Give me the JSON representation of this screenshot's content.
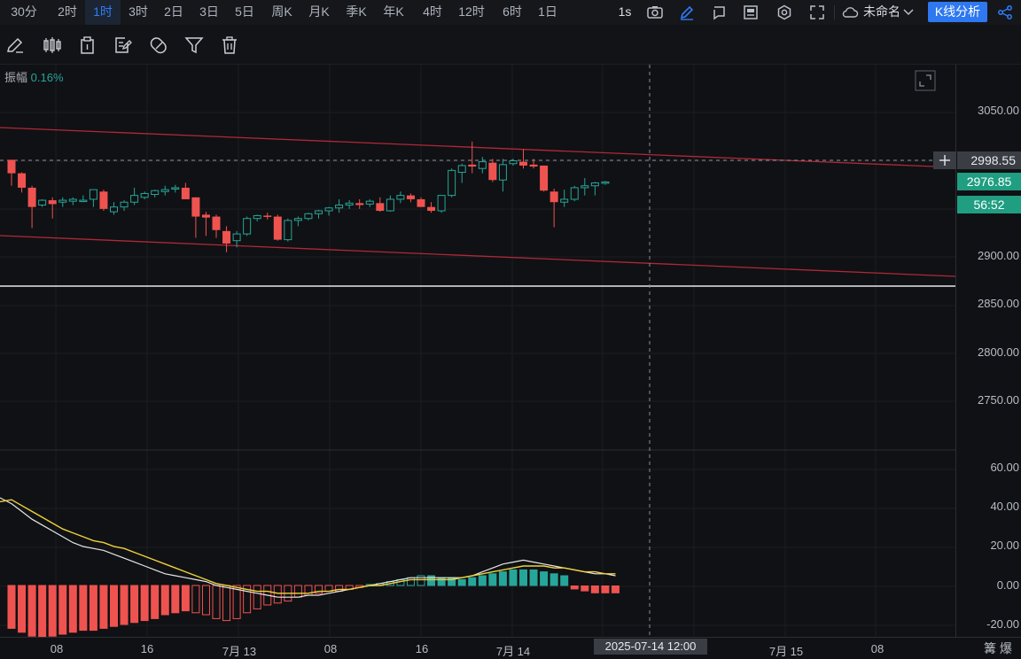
{
  "timeframes": [
    {
      "label": "30分",
      "active": false
    },
    {
      "label": "2时",
      "active": false
    },
    {
      "label": "1时",
      "active": true
    },
    {
      "label": "3时",
      "active": false
    },
    {
      "label": "2日",
      "active": false
    },
    {
      "label": "3日",
      "active": false
    },
    {
      "label": "5日",
      "active": false
    },
    {
      "label": "周K",
      "active": false
    },
    {
      "label": "月K",
      "active": false
    },
    {
      "label": "季K",
      "active": false
    },
    {
      "label": "年K",
      "active": false
    },
    {
      "label": "4时",
      "active": false
    },
    {
      "label": "12时",
      "active": false
    },
    {
      "label": "6时",
      "active": false
    },
    {
      "label": "1日",
      "active": false
    }
  ],
  "topbar": {
    "interval_badge": "1s",
    "layout_name": "未命名",
    "analysis_button": "K线分析"
  },
  "amplitude": {
    "label": "振幅",
    "value": "0.16%"
  },
  "price_axis": [
    "3050.00",
    "2900.00",
    "2850.00",
    "2800.00",
    "2750.00"
  ],
  "price_tags": {
    "crosshair": "2998.55",
    "last": "2976.85",
    "countdown": "56:52"
  },
  "macd_axis": [
    "60.00",
    "40.00",
    "20.00",
    "0.00",
    "-20.00"
  ],
  "time_axis": [
    "08",
    "16",
    "7月 13",
    "08",
    "16",
    "7月 14",
    "7月 15",
    "08"
  ],
  "crosshair_time": "2025-07-14 12:00",
  "corner_label": "篝 爆",
  "colors": {
    "up": "#26a69a",
    "down": "#ef5350",
    "accent": "#2e78f0",
    "channel": "#b0283a"
  },
  "chart_data": {
    "type": "candlestick",
    "ylim": [
      2720,
      3075
    ],
    "candles": [
      [
        2999,
        2999,
        2972,
        2985
      ],
      [
        2985,
        2986,
        2965,
        2970
      ],
      [
        2970,
        2972,
        2928,
        2950
      ],
      [
        2952,
        2958,
        2950,
        2957
      ],
      [
        2957,
        2960,
        2938,
        2953
      ],
      [
        2955,
        2960,
        2950,
        2957
      ],
      [
        2956,
        2960,
        2952,
        2958
      ],
      [
        2956,
        2962,
        2955,
        2957
      ],
      [
        2958,
        2960,
        2950,
        2968
      ],
      [
        2966,
        2968,
        2946,
        2948
      ],
      [
        2945,
        2955,
        2942,
        2950
      ],
      [
        2950,
        2957,
        2946,
        2955
      ],
      [
        2955,
        2970,
        2952,
        2962
      ],
      [
        2960,
        2966,
        2958,
        2964
      ],
      [
        2963,
        2968,
        2960,
        2967
      ],
      [
        2966,
        2972,
        2962,
        2968
      ],
      [
        2970,
        2973,
        2965,
        2970
      ],
      [
        2970,
        2975,
        2958,
        2958
      ],
      [
        2960,
        2960,
        2918,
        2940
      ],
      [
        2942,
        2945,
        2920,
        2939
      ],
      [
        2940,
        2942,
        2918,
        2926
      ],
      [
        2925,
        2930,
        2903,
        2912
      ],
      [
        2915,
        2925,
        2908,
        2922
      ],
      [
        2922,
        2940,
        2920,
        2938
      ],
      [
        2938,
        2942,
        2935,
        2941
      ],
      [
        2941,
        2944,
        2937,
        2940
      ],
      [
        2940,
        2942,
        2915,
        2916
      ],
      [
        2916,
        2938,
        2914,
        2936
      ],
      [
        2936,
        2940,
        2930,
        2938
      ],
      [
        2938,
        2944,
        2936,
        2943
      ],
      [
        2943,
        2947,
        2938,
        2946
      ],
      [
        2946,
        2950,
        2941,
        2949
      ],
      [
        2949,
        2958,
        2944,
        2952
      ],
      [
        2952,
        2957,
        2948,
        2954
      ],
      [
        2954,
        2958,
        2948,
        2952
      ],
      [
        2953,
        2958,
        2950,
        2956
      ],
      [
        2954,
        2960,
        2945,
        2946
      ],
      [
        2946,
        2962,
        2945,
        2958
      ],
      [
        2958,
        2966,
        2954,
        2962
      ],
      [
        2962,
        2964,
        2955,
        2958
      ],
      [
        2958,
        2960,
        2950,
        2950
      ],
      [
        2950,
        2955,
        2944,
        2946
      ],
      [
        2946,
        2962,
        2944,
        2962
      ],
      [
        2962,
        2990,
        2960,
        2988
      ],
      [
        2986,
        2995,
        2975,
        2993
      ],
      [
        2994,
        3018,
        2985,
        2992
      ],
      [
        2990,
        3002,
        2985,
        2997
      ],
      [
        2996,
        3000,
        2976,
        2978
      ],
      [
        2978,
        3000,
        2966,
        2994
      ],
      [
        2995,
        3000,
        2993,
        2998
      ],
      [
        2997,
        3010,
        2990,
        2993
      ],
      [
        2994,
        3000,
        2990,
        2992
      ],
      [
        2993,
        2993,
        2966,
        2967
      ],
      [
        2966,
        2969,
        2929,
        2955
      ],
      [
        2955,
        2968,
        2950,
        2958
      ],
      [
        2958,
        2972,
        2956,
        2970
      ],
      [
        2970,
        2980,
        2962,
        2972
      ],
      [
        2972,
        2976,
        2962,
        2975
      ],
      [
        2975,
        2977,
        2973,
        2976
      ]
    ],
    "macd": {
      "hist": [
        -22,
        -24,
        -26,
        -27,
        -26,
        -25,
        -24,
        -23,
        -23,
        -22,
        -21,
        -20,
        -19,
        -18,
        -17,
        -15,
        -14,
        -13,
        -14,
        -15,
        -17,
        -18,
        -17,
        -14,
        -12,
        -10,
        -9,
        -8,
        -6,
        -5,
        -4,
        -3,
        -3,
        -2,
        -1,
        0.5,
        1,
        2,
        3,
        4,
        5,
        5,
        4,
        4,
        3,
        4,
        5,
        6,
        7,
        8,
        8,
        8,
        7,
        6,
        5,
        -2,
        -3,
        -4,
        -4,
        -4
      ],
      "dif": [
        42,
        38,
        34,
        31,
        28,
        25,
        22,
        20,
        19,
        18,
        16,
        14,
        12,
        10,
        8,
        6,
        5,
        4,
        3,
        2,
        0,
        -1,
        -2,
        -3,
        -4,
        -5,
        -6,
        -6,
        -6,
        -5,
        -5,
        -4,
        -3,
        -2,
        -1,
        0,
        1,
        2,
        3,
        4,
        4,
        4,
        4,
        4,
        4,
        5,
        7,
        9,
        11,
        12,
        13,
        12,
        11,
        10,
        9,
        8,
        7,
        6,
        6,
        5
      ],
      "dea": [
        44,
        41,
        38,
        35,
        32,
        29,
        27,
        25,
        23,
        22,
        20,
        19,
        17,
        15,
        13,
        11,
        9,
        7,
        5,
        3,
        1,
        0,
        -1,
        -2,
        -3,
        -3,
        -4,
        -4,
        -4,
        -4,
        -3,
        -3,
        -2,
        -2,
        -1,
        0,
        0,
        1,
        2,
        3,
        3,
        3,
        3,
        3,
        4,
        5,
        6,
        7,
        8,
        9,
        10,
        10,
        10,
        9,
        9,
        8,
        7,
        7,
        6,
        6
      ]
    }
  }
}
